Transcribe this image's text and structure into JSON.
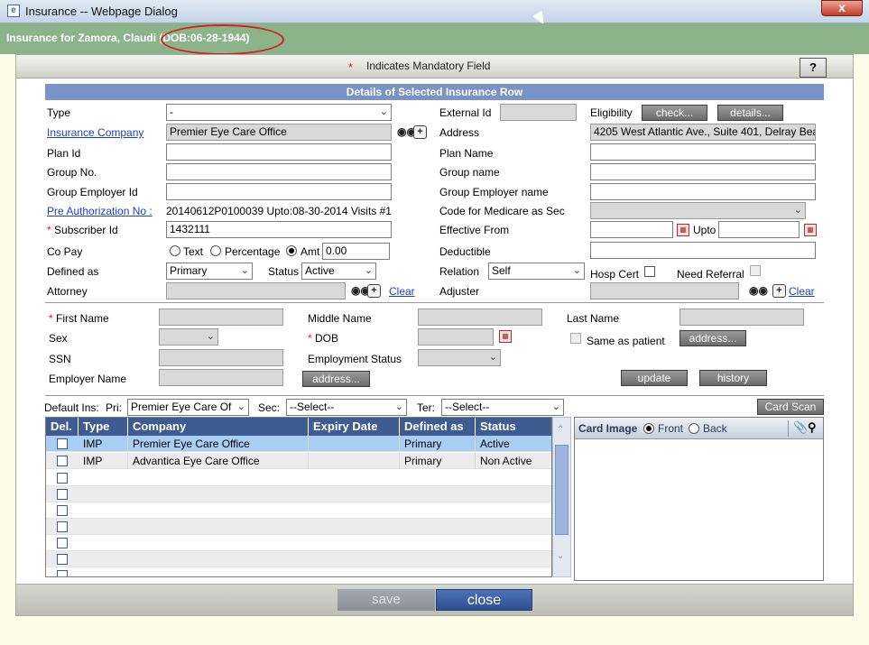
{
  "window": {
    "title": "Insurance -- Webpage Dialog",
    "close_glyph": "x"
  },
  "header": {
    "patient_title": "Insurance for Zamora, Claudi",
    "dob": "(DOB:06-28-1944)"
  },
  "mandatory": {
    "star": "*",
    "text": "Indicates Mandatory Field",
    "help": "?"
  },
  "details": {
    "title": "Details of Selected Insurance Row",
    "type_label": "Type",
    "type_value": "-",
    "external_id_label": "External Id",
    "external_id_value": "",
    "eligibility_label": "Eligibility",
    "check_btn": "check...",
    "details_btn": "details...",
    "insurance_company_label": "Insurance Company",
    "insurance_company_value": "Premier Eye Care Office",
    "address_label": "Address",
    "address_value": "4205 West Atlantic Ave., Suite 401, Delray Bea",
    "plan_id_label": "Plan Id",
    "plan_id_value": "",
    "plan_name_label": "Plan Name",
    "plan_name_value": "",
    "group_no_label": "Group No.",
    "group_no_value": "",
    "group_name_label": "Group name",
    "group_name_value": "",
    "group_employer_id_label": "Group Employer Id",
    "group_employer_id_value": "",
    "group_employer_name_label": "Group Employer name",
    "group_employer_name_value": "",
    "pre_auth_label": "Pre Authorization No :",
    "pre_auth_value": "20140612P0100039 Upto:08-30-2014   Visits #1",
    "medicare_label": "Code for Medicare as Sec",
    "medicare_value": "",
    "subscriber_id_label": "Subscriber Id",
    "subscriber_id_value": "1432111",
    "effective_from_label": "Effective From",
    "effective_from_value": "",
    "upto_label": "Upto",
    "upto_value": "",
    "copay_label": "Co Pay",
    "copay_text": "Text",
    "copay_percentage": "Percentage",
    "copay_amt": "Amt",
    "copay_value": "0.00",
    "deductible_label": "Deductible",
    "deductible_value": "",
    "defined_as_label": "Defined as",
    "defined_as_value": "Primary",
    "status_label": "Status",
    "status_value": "Active",
    "relation_label": "Relation",
    "relation_value": "Self",
    "hosp_cert_label": "Hosp Cert",
    "need_referral_label": "Need Referral",
    "attorney_label": "Attorney",
    "attorney_value": "",
    "attorney_clear": "Clear",
    "adjuster_label": "Adjuster",
    "adjuster_value": "",
    "adjuster_clear": "Clear"
  },
  "subscriber": {
    "first_name_label": "First Name",
    "middle_name_label": "Middle Name",
    "last_name_label": "Last Name",
    "sex_label": "Sex",
    "dob_label": "DOB",
    "same_as_patient_label": "Same as patient",
    "address_btn1": "address...",
    "ssn_label": "SSN",
    "employment_status_label": "Employment Status",
    "employer_name_label": "Employer Name",
    "address_btn2": "address...",
    "update_btn": "update",
    "history_btn": "history"
  },
  "defaults": {
    "label": "Default Ins:",
    "pri_label": "Pri:",
    "pri_value": "Premier Eye Care Of",
    "sec_label": "Sec:",
    "sec_value": "--Select--",
    "ter_label": "Ter:",
    "ter_value": "--Select--",
    "card_scan_btn": "Card Scan"
  },
  "table": {
    "columns": [
      "Del.",
      "Type",
      "Company",
      "Expiry Date",
      "Defined as",
      "Status"
    ],
    "rows": [
      {
        "type": "IMP",
        "company": "Premier Eye Care Office",
        "expiry": "",
        "defined_as": "Primary",
        "status": "Active"
      },
      {
        "type": "IMP",
        "company": "Advantica Eye Care Office",
        "expiry": "",
        "defined_as": "Primary",
        "status": "Non Active"
      }
    ]
  },
  "card": {
    "label": "Card Image",
    "front": "Front",
    "back": "Back"
  },
  "footer": {
    "save": "save",
    "close": "close"
  }
}
